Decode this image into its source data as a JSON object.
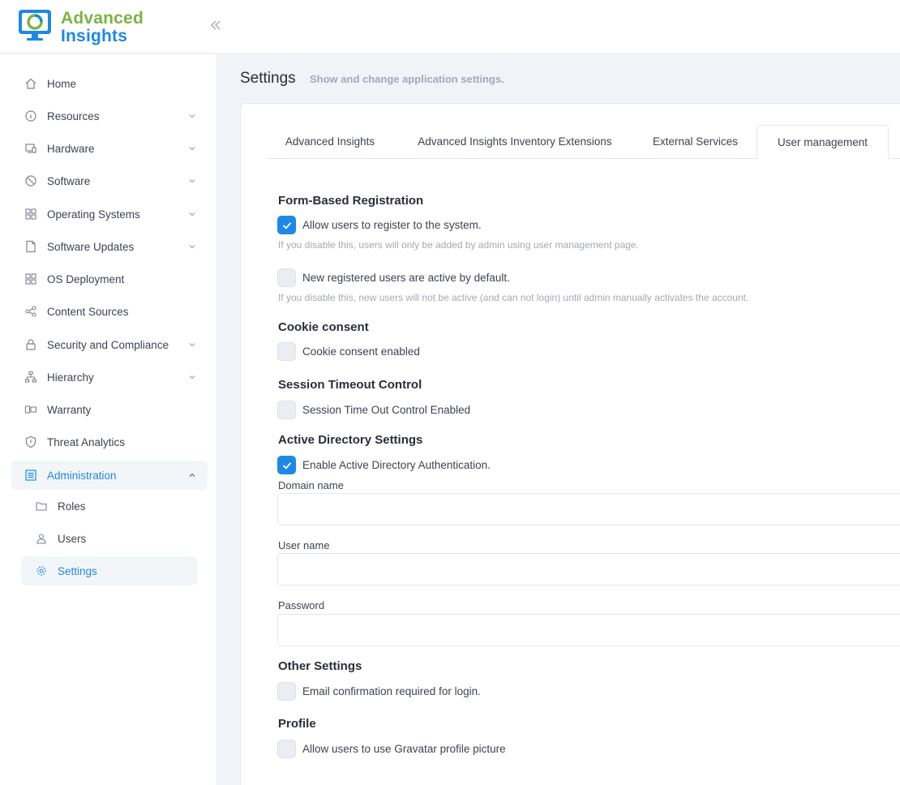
{
  "brand": {
    "line1": "Advanced",
    "line2": "Insights",
    "colors": {
      "green": "#7cb342",
      "blue": "#1e88e5"
    }
  },
  "sidebar": {
    "items": [
      {
        "label": "Home",
        "icon": "home-icon",
        "expandable": false
      },
      {
        "label": "Resources",
        "icon": "info-circle-icon",
        "expandable": true
      },
      {
        "label": "Hardware",
        "icon": "hardware-icon",
        "expandable": true
      },
      {
        "label": "Software",
        "icon": "software-icon",
        "expandable": true
      },
      {
        "label": "Operating Systems",
        "icon": "windows-icon",
        "expandable": true
      },
      {
        "label": "Software Updates",
        "icon": "file-update-icon",
        "expandable": true
      },
      {
        "label": "OS Deployment",
        "icon": "windows-icon",
        "expandable": false
      },
      {
        "label": "Content Sources",
        "icon": "share-icon",
        "expandable": false
      },
      {
        "label": "Security and Compliance",
        "icon": "lock-icon",
        "expandable": true
      },
      {
        "label": "Hierarchy",
        "icon": "hierarchy-icon",
        "expandable": true
      },
      {
        "label": "Warranty",
        "icon": "warranty-icon",
        "expandable": false
      },
      {
        "label": "Threat Analytics",
        "icon": "shield-icon",
        "expandable": false
      },
      {
        "label": "Administration",
        "icon": "admin-icon",
        "expandable": true,
        "active": true
      }
    ],
    "admin_sub": [
      {
        "label": "Roles",
        "icon": "folder-icon"
      },
      {
        "label": "Users",
        "icon": "users-icon"
      },
      {
        "label": "Settings",
        "icon": "gear-icon",
        "active": true
      }
    ]
  },
  "page": {
    "title": "Settings",
    "subtitle": "Show and change application settings."
  },
  "tabs": [
    {
      "label": "Advanced Insights"
    },
    {
      "label": "Advanced Insights Inventory Extensions"
    },
    {
      "label": "External Services"
    },
    {
      "label": "User management",
      "active": true
    }
  ],
  "form": {
    "registration": {
      "title": "Form-Based Registration",
      "allow_register": {
        "label": "Allow users to register to the system.",
        "checked": true,
        "help": "If you disable this, users will only be added by admin using user management page."
      },
      "active_default": {
        "label": "New registered users are active by default.",
        "checked": false,
        "help": "If you disable this, new users will not be active (and can not login) until admin manually activates the account."
      }
    },
    "cookie": {
      "title": "Cookie consent",
      "enabled": {
        "label": "Cookie consent enabled",
        "checked": false
      }
    },
    "session": {
      "title": "Session Timeout Control",
      "enabled": {
        "label": "Session Time Out Control Enabled",
        "checked": false
      }
    },
    "ad": {
      "title": "Active Directory Settings",
      "enabled": {
        "label": "Enable Active Directory Authentication.",
        "checked": true
      },
      "domain_label": "Domain name",
      "domain_value": "",
      "user_label": "User name",
      "user_value": "",
      "password_label": "Password",
      "password_value": ""
    },
    "other": {
      "title": "Other Settings",
      "email_confirm": {
        "label": "Email confirmation required for login.",
        "checked": false
      }
    },
    "profile": {
      "title": "Profile",
      "gravatar": {
        "label": "Allow users to use Gravatar profile picture",
        "checked": false
      }
    }
  }
}
